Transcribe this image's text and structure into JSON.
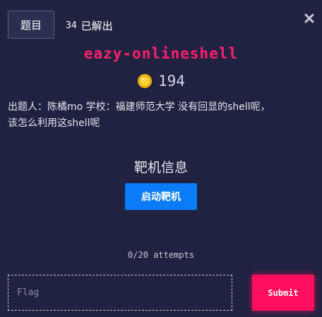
{
  "header": {
    "tab_label": "题目",
    "solve_count": "34",
    "solve_label": "已解出"
  },
  "challenge": {
    "title": "eazy-onlineshell",
    "points": "194",
    "description_line1": "出题人：陈橘mo 学校：福建师范大学 没有回显的shell呢，",
    "description_line2": "该怎么利用这shell呢"
  },
  "target": {
    "title": "靶机信息",
    "launch_label": "启动靶机"
  },
  "attempts": "0/20 attempts",
  "flag": {
    "placeholder": "Flag",
    "value": ""
  },
  "submit_label": "Submit",
  "icons": {
    "close": "close-icon",
    "coin": "coin-icon"
  },
  "colors": {
    "background": "#1f2240",
    "title": "#ff1f6d",
    "launch_button": "#0a7cf9",
    "submit_button": "#ff0f5e"
  }
}
